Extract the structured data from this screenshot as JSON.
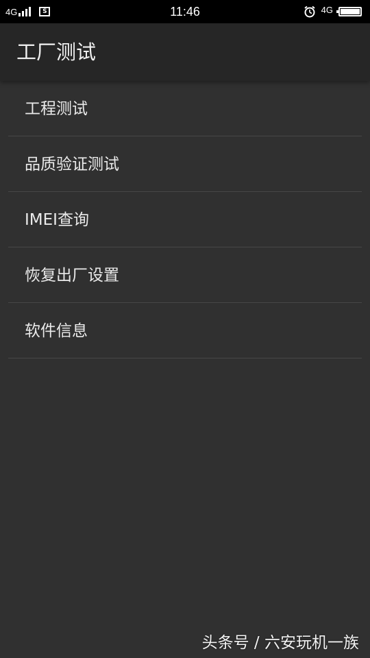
{
  "status_bar": {
    "network_left": "4G",
    "sim_label": "S",
    "time": "11:46",
    "network_right": "4G",
    "icons": [
      "signal-icon",
      "sim-icon",
      "alarm-icon",
      "battery-icon"
    ]
  },
  "app_bar": {
    "title": "工厂测试"
  },
  "menu": {
    "items": [
      {
        "label": "工程测试"
      },
      {
        "label": "品质验证测试"
      },
      {
        "label": "IMEI查询"
      },
      {
        "label": "恢复出厂设置"
      },
      {
        "label": "软件信息"
      }
    ]
  },
  "watermark": "头条号 / 六安玩机一族",
  "colors": {
    "background": "#303030",
    "app_bar": "#262626",
    "status_bar": "#000000",
    "divider": "#474747",
    "text": "#eaeaea"
  }
}
